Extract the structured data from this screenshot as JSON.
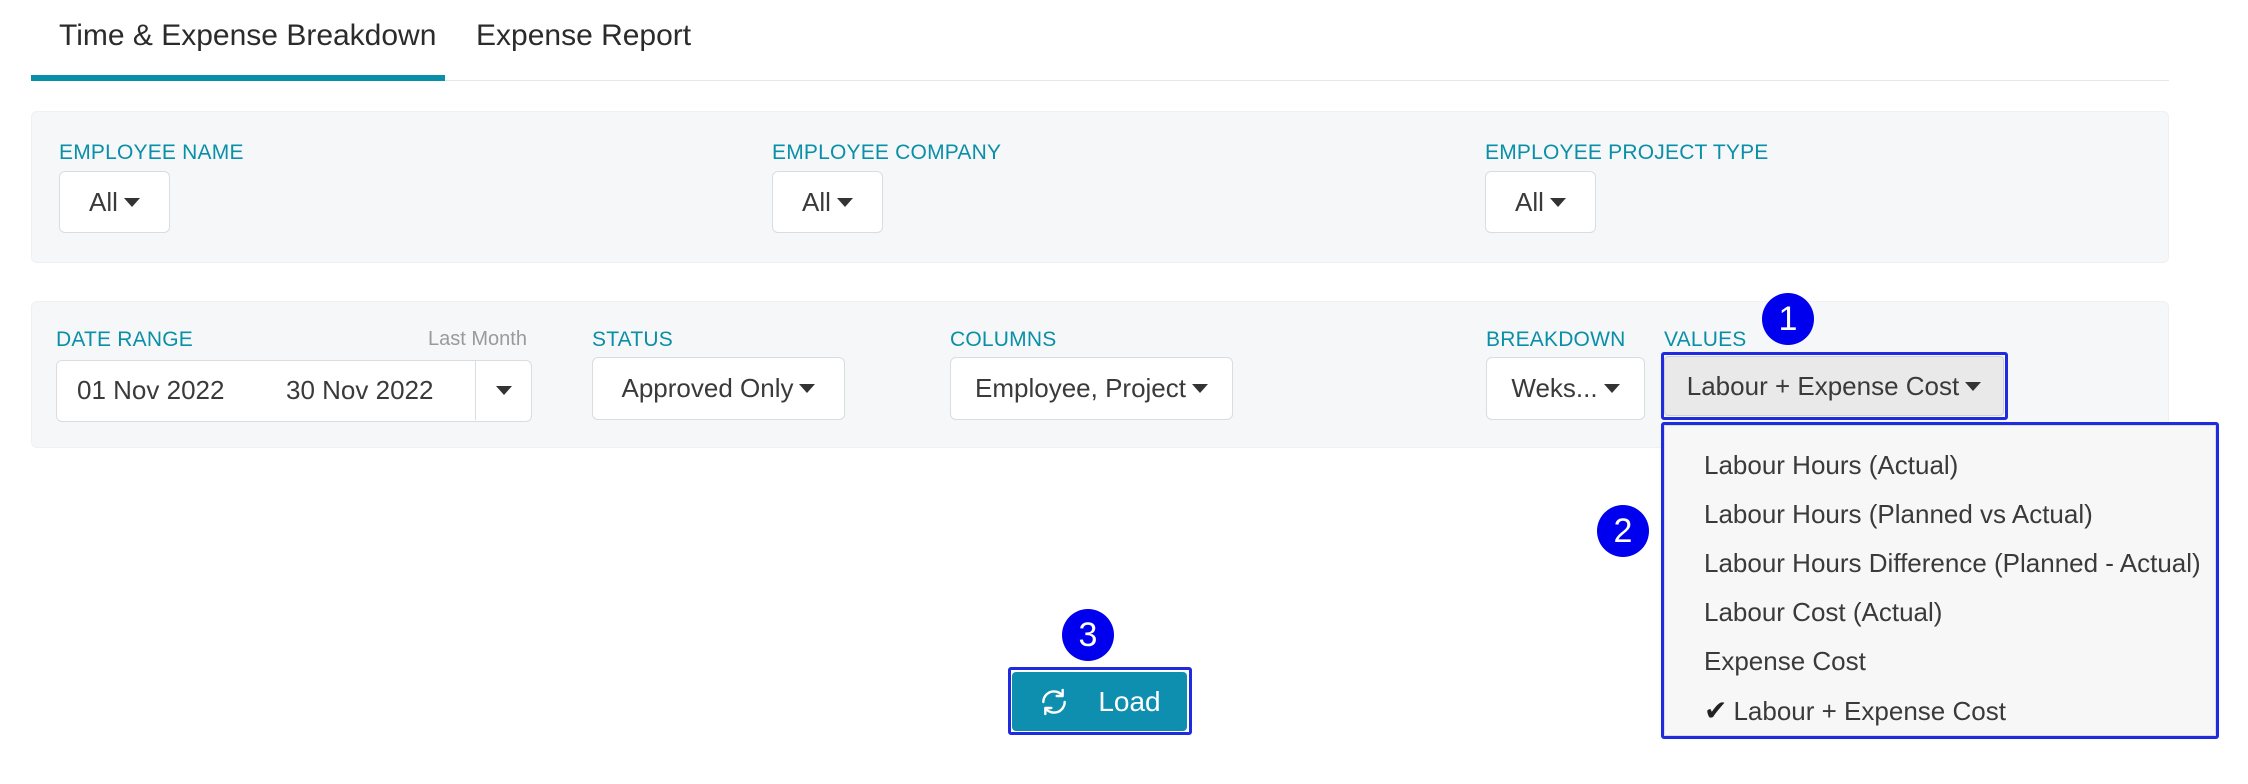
{
  "tabs": [
    {
      "label": "Time & Expense Breakdown",
      "active": true
    },
    {
      "label": "Expense Report",
      "active": false
    }
  ],
  "filters_top": {
    "employee_name": {
      "label": "EMPLOYEE NAME",
      "value": "All"
    },
    "employee_company": {
      "label": "EMPLOYEE COMPANY",
      "value": "All"
    },
    "employee_project_type": {
      "label": "EMPLOYEE PROJECT TYPE",
      "value": "All"
    }
  },
  "filters_bottom": {
    "date_range": {
      "label": "DATE RANGE",
      "preset": "Last Month",
      "start": "01 Nov 2022",
      "end": "30 Nov 2022"
    },
    "status": {
      "label": "STATUS",
      "value": "Approved Only"
    },
    "columns": {
      "label": "COLUMNS",
      "value": "Employee, Project"
    },
    "breakdown": {
      "label": "BREAKDOWN",
      "value": "Weks..."
    },
    "values": {
      "label": "VALUES",
      "value": "Labour + Expense Cost",
      "options": [
        "Labour Hours (Actual)",
        "Labour Hours (Planned vs Actual)",
        "Labour Hours Difference (Planned - Actual)",
        "Labour Cost (Actual)",
        "Expense Cost",
        "Labour + Expense Cost"
      ],
      "selected_index": 5
    }
  },
  "load_button": {
    "label": "Load"
  },
  "annotations": {
    "badge1": "1",
    "badge2": "2",
    "badge3": "3"
  },
  "colors": {
    "accent": "#0a8fa8",
    "load_button": "#0f8fb0",
    "annotation": "#1e2be0"
  },
  "icons": {
    "refresh": "refresh-icon",
    "caret": "caret-down-icon",
    "check": "check-icon"
  }
}
